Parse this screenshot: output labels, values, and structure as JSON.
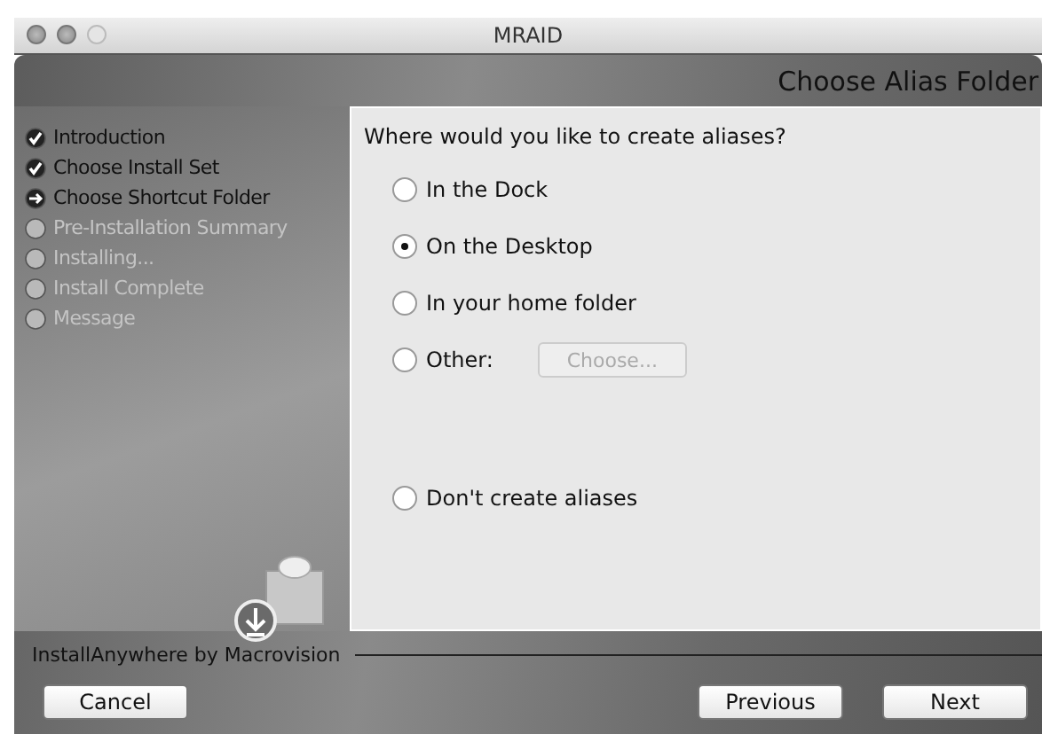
{
  "window": {
    "title": "MRAID"
  },
  "header": {
    "title": "Choose Alias Folder"
  },
  "steps": [
    {
      "label": "Introduction",
      "completed": true,
      "current": false
    },
    {
      "label": "Choose Install Set",
      "completed": true,
      "current": false
    },
    {
      "label": "Choose Shortcut Folder",
      "completed": false,
      "current": true
    },
    {
      "label": "Pre-Installation Summary",
      "completed": false,
      "current": false
    },
    {
      "label": "Installing...",
      "completed": false,
      "current": false
    },
    {
      "label": "Install Complete",
      "completed": false,
      "current": false
    },
    {
      "label": "Message",
      "completed": false,
      "current": false
    }
  ],
  "question": "Where would you like to create aliases?",
  "options": [
    {
      "label": "In the Dock",
      "selected": false
    },
    {
      "label": "On the Desktop",
      "selected": true
    },
    {
      "label": "In your home folder",
      "selected": false
    },
    {
      "label": "Other:",
      "selected": false,
      "button": {
        "label": "Choose...",
        "disabled": true
      }
    },
    {
      "label": "Don't create aliases",
      "selected": false
    }
  ],
  "brand": "InstallAnywhere by Macrovision",
  "buttons": {
    "cancel": "Cancel",
    "previous": "Previous",
    "next": "Next"
  }
}
